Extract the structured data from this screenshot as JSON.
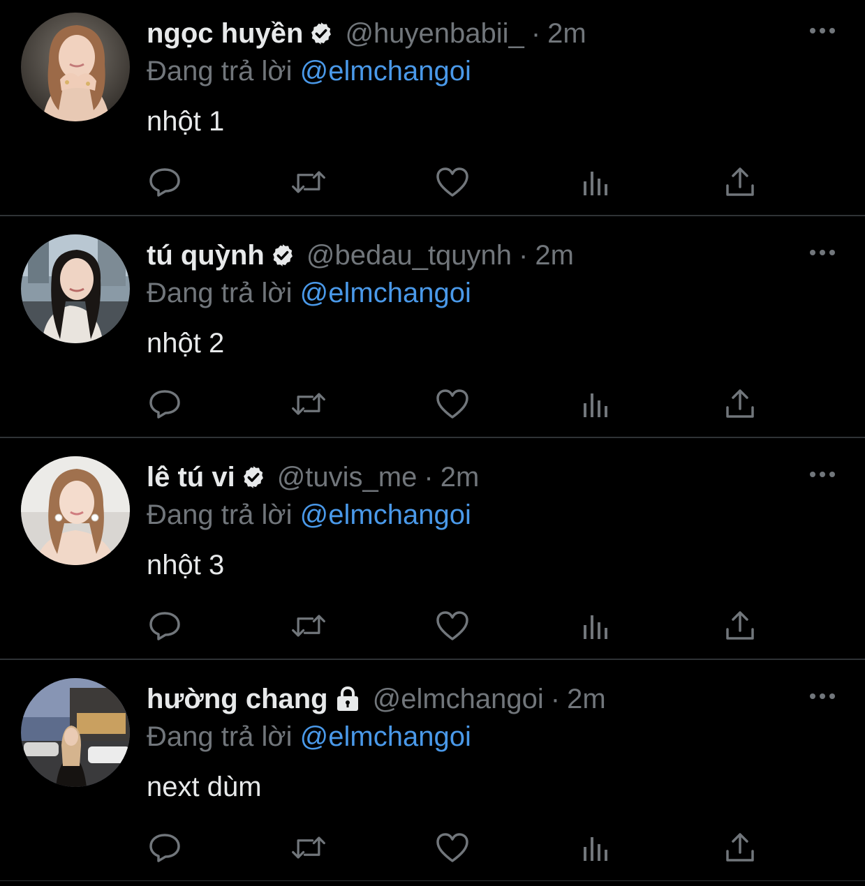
{
  "colors": {
    "background": "#000000",
    "divider": "#2f3336",
    "primary_text": "#e7e9ea",
    "secondary_text": "#71767b",
    "link": "#4a99e9",
    "icon": "#71767b"
  },
  "tweets": [
    {
      "name": "ngọc huyền",
      "badge": "verified-icon",
      "handle": "@huyenbabii_",
      "separator": "·",
      "time": "2m",
      "reply_prefix": "Đang trả lời",
      "reply_to": "@elmchangoi",
      "text": "nhột 1",
      "avatar": "profile-photo-woman-with-rings"
    },
    {
      "name": "tú quỳnh",
      "badge": "verified-icon",
      "handle": "@bedau_tquynh",
      "separator": "·",
      "time": "2m",
      "reply_prefix": "Đang trả lời",
      "reply_to": "@elmchangoi",
      "text": "nhột 2",
      "avatar": "profile-photo-woman-city-street"
    },
    {
      "name": "lê tú vi",
      "badge": "verified-icon",
      "handle": "@tuvis_me",
      "separator": "·",
      "time": "2m",
      "reply_prefix": "Đang trả lời",
      "reply_to": "@elmchangoi",
      "text": "nhột 3",
      "avatar": "profile-photo-woman-pearl-earrings"
    },
    {
      "name": "hường chang",
      "badge": "lock-icon",
      "handle": "@elmchangoi",
      "separator": "·",
      "time": "2m",
      "reply_prefix": "Đang trả lời",
      "reply_to": "@elmchangoi",
      "text": "next dùm",
      "avatar": "profile-photo-woman-paris-street"
    }
  ],
  "action_icons": [
    "reply-icon",
    "retweet-icon",
    "like-icon",
    "views-icon",
    "share-icon"
  ]
}
